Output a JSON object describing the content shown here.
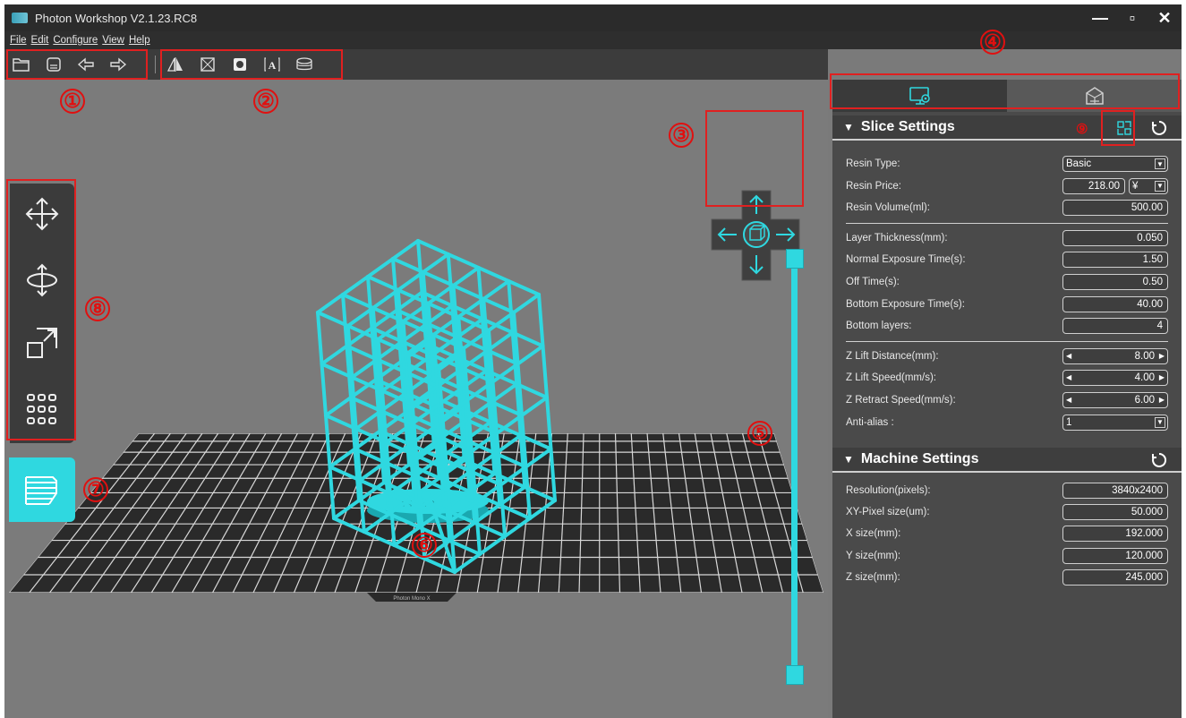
{
  "window": {
    "title": "Photon Workshop V2.1.23.RC8",
    "controls": [
      "—",
      "▫",
      "✕"
    ]
  },
  "menu": [
    {
      "label": "File"
    },
    {
      "label": "Edit"
    },
    {
      "label": "Configure"
    },
    {
      "label": "View"
    },
    {
      "label": "Help"
    }
  ],
  "annotations": [
    "①",
    "②",
    "③",
    "④",
    "⑤",
    "⑥",
    "⑦",
    "⑧",
    "⑨"
  ],
  "build_plate_label": "Photon Mono X",
  "base_label": "⚘⚘⚘⚘⚘",
  "slice_settings": {
    "title": "Slice Settings",
    "caret": "▼",
    "rows": [
      {
        "label": "Resin Type:",
        "value": "Basic"
      },
      {
        "label": "Resin Price:",
        "value": "218.00",
        "currency": "¥"
      },
      {
        "label": "Resin Volume(ml):",
        "value": "500.00"
      },
      {
        "label": "Layer Thickness(mm):",
        "value": "0.050"
      },
      {
        "label": "Normal Exposure Time(s):",
        "value": "1.50"
      },
      {
        "label": "Off Time(s):",
        "value": "0.50"
      },
      {
        "label": "Bottom Exposure Time(s):",
        "value": "40.00"
      },
      {
        "label": "Bottom layers:",
        "value": "4"
      },
      {
        "label": "Z Lift Distance(mm):",
        "value": "8.00"
      },
      {
        "label": "Z Lift Speed(mm/s):",
        "value": "4.00"
      },
      {
        "label": "Z Retract Speed(mm/s):",
        "value": "6.00"
      },
      {
        "label": "Anti-alias :",
        "value": "1"
      }
    ]
  },
  "machine_settings": {
    "title": "Machine Settings",
    "caret": "▼",
    "rows": [
      {
        "label": "Resolution(pixels):",
        "value": "3840x2400"
      },
      {
        "label": "XY-Pixel size(um):",
        "value": "50.000"
      },
      {
        "label": "X size(mm):",
        "value": "192.000"
      },
      {
        "label": "Y size(mm):",
        "value": "120.000"
      },
      {
        "label": "Z size(mm):",
        "value": "245.000"
      }
    ]
  },
  "colors": {
    "accent": "#2fd8e0",
    "annotation": "#e01010",
    "panel": "#4a4a4a",
    "viewport": "#7b7b7b"
  }
}
